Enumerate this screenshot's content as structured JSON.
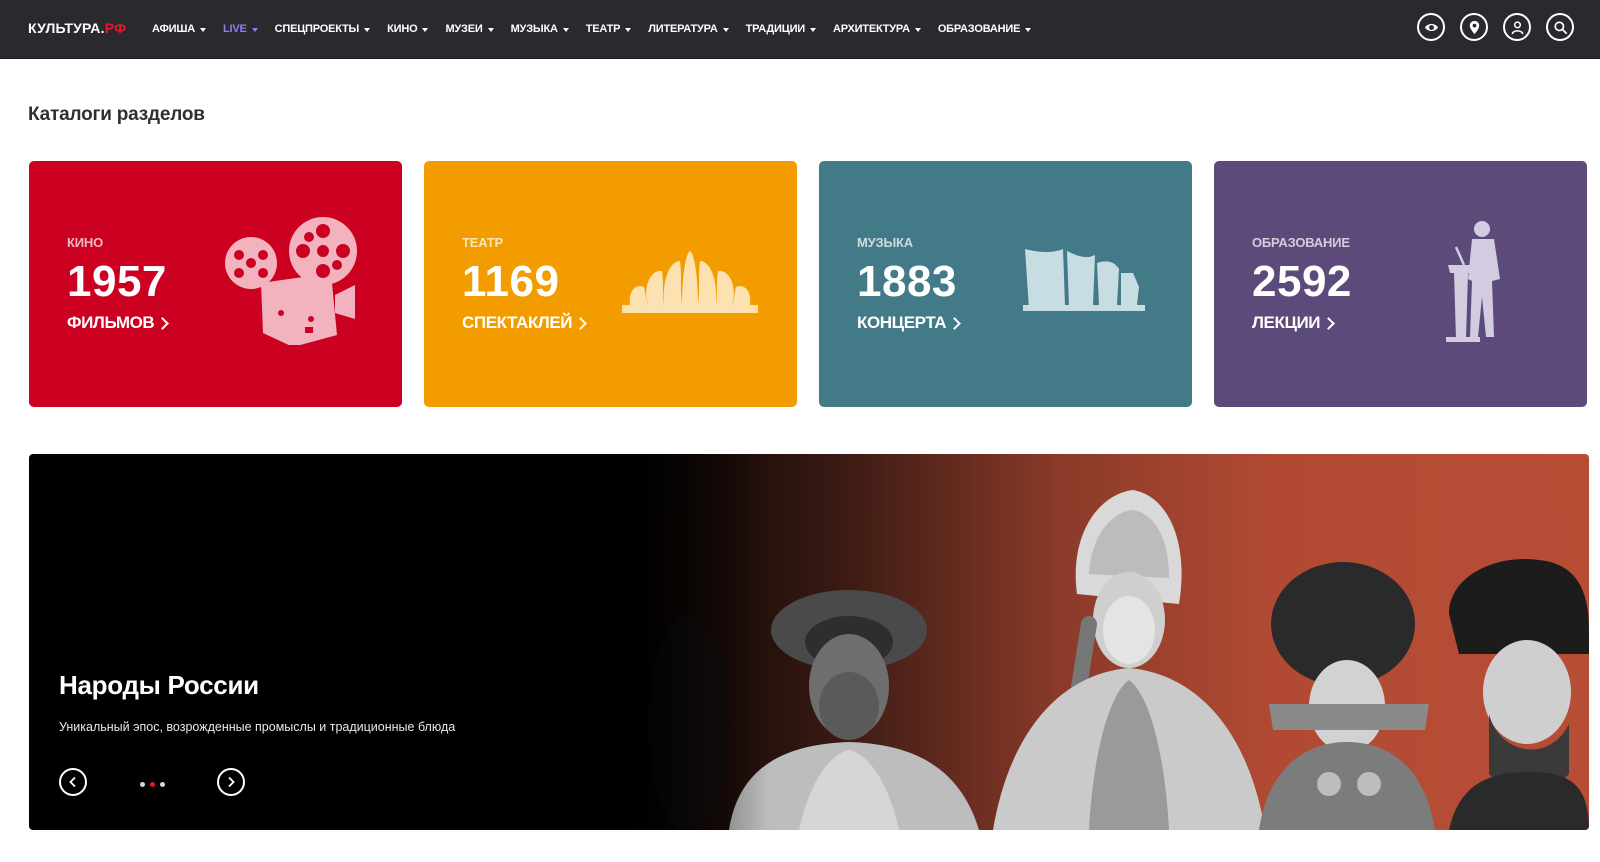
{
  "header": {
    "logo_main": "КУЛЬТУРА.",
    "logo_domain": "РФ",
    "nav": [
      {
        "label": "АФИША",
        "active": false
      },
      {
        "label": "LIVE",
        "active": true
      },
      {
        "label": "СПЕЦПРОЕКТЫ",
        "active": false
      },
      {
        "label": "КИНО",
        "active": false
      },
      {
        "label": "МУЗЕИ",
        "active": false
      },
      {
        "label": "МУЗЫКА",
        "active": false
      },
      {
        "label": "ТЕАТР",
        "active": false
      },
      {
        "label": "ЛИТЕРАТУРА",
        "active": false
      },
      {
        "label": "ТРАДИЦИИ",
        "active": false
      },
      {
        "label": "АРХИТЕКТУРА",
        "active": false
      },
      {
        "label": "ОБРАЗОВАНИЕ",
        "active": false
      }
    ],
    "icons": [
      "eye-icon",
      "location-pin-icon",
      "user-icon",
      "search-icon"
    ],
    "colors": {
      "background": "#2a2a2e",
      "active_link": "#8e7cf0",
      "logo_accent": "#e3192d"
    }
  },
  "catalogs": {
    "title": "Каталоги разделов",
    "cards": [
      {
        "category": "КИНО",
        "count": "1957",
        "unit": "ФИЛЬМОВ",
        "color": "#cc0020",
        "icon": "film-projector-icon"
      },
      {
        "category": "ТЕАТР",
        "count": "1169",
        "unit": "СПЕКТАКЛЕЙ",
        "color": "#f39c00",
        "icon": "theatre-shell-icon"
      },
      {
        "category": "МУЗЫКА",
        "count": "1883",
        "unit": "КОНЦЕРТА",
        "color": "#427a87",
        "icon": "concert-hall-icon"
      },
      {
        "category": "ОБРАЗОВАНИЕ",
        "count": "2592",
        "unit": "ЛЕКЦИИ",
        "color": "#5c4a7a",
        "icon": "lecturer-icon"
      }
    ]
  },
  "banner": {
    "title": "Народы России",
    "subtitle": "Уникальный эпос, возрожденные промыслы и традиционные блюда",
    "slides_total": 3,
    "active_slide": 2
  }
}
